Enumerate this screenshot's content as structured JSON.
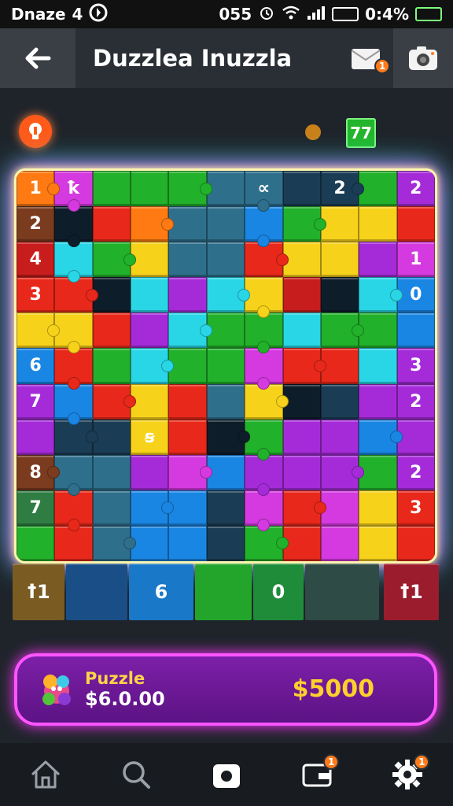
{
  "status_bar": {
    "left_text": "Dnaze",
    "left_num": "4",
    "time": "055",
    "battery_text": "0:4%"
  },
  "app_bar": {
    "title": "Duzzlea Inuzzla",
    "mail_badge": "1",
    "back_icon": "back-arrow-icon",
    "mail_icon": "mail-icon",
    "camera_icon": "camera-icon"
  },
  "game": {
    "level": "77",
    "hint_icon": "hint-bulb-icon",
    "board": {
      "colors": {
        "R": "#e8281a",
        "O": "#ff7a12",
        "Y": "#f7d21a",
        "G": "#22b12a",
        "C": "#29d6e6",
        "B": "#1a86e3",
        "P": "#a52bd9",
        "M": "#d43adf",
        "D": "#1a3d55",
        "T": "#2e6f8c",
        "N": "#c71d1d",
        "K": "#0e1d2a",
        "W": "#7a3b1e",
        "L": "#2f7d43"
      },
      "rows": [
        [
          "O",
          "M",
          "G",
          "G",
          "G",
          "T",
          "T",
          "D",
          "D",
          "G",
          "P"
        ],
        [
          "W",
          "K",
          "R",
          "O",
          "T",
          "T",
          "B",
          "G",
          "Y",
          "Y",
          "R"
        ],
        [
          "N",
          "C",
          "G",
          "Y",
          "T",
          "T",
          "R",
          "Y",
          "Y",
          "P",
          "M"
        ],
        [
          "R",
          "R",
          "K",
          "C",
          "P",
          "C",
          "Y",
          "N",
          "K",
          "C",
          "B"
        ],
        [
          "Y",
          "Y",
          "R",
          "P",
          "C",
          "G",
          "G",
          "C",
          "G",
          "G",
          "B"
        ],
        [
          "B",
          "R",
          "G",
          "C",
          "G",
          "G",
          "M",
          "R",
          "R",
          "C",
          "P"
        ],
        [
          "P",
          "B",
          "R",
          "Y",
          "R",
          "T",
          "Y",
          "K",
          "D",
          "P",
          "P"
        ],
        [
          "P",
          "D",
          "D",
          "Y",
          "R",
          "K",
          "G",
          "P",
          "P",
          "B",
          "P"
        ],
        [
          "W",
          "T",
          "T",
          "P",
          "M",
          "B",
          "P",
          "P",
          "P",
          "G",
          "P"
        ],
        [
          "L",
          "R",
          "T",
          "B",
          "B",
          "D",
          "M",
          "R",
          "M",
          "Y",
          "R"
        ],
        [
          "G",
          "R",
          "T",
          "B",
          "B",
          "D",
          "G",
          "R",
          "M",
          "Y",
          "R"
        ]
      ],
      "labels": {
        "0-0": "1",
        "0-1": "ꝁ",
        "0-6": "∝",
        "0-8": "2",
        "0-10": "2",
        "1-0": "2",
        "2-0": "4",
        "2-10": "1",
        "3-0": "3",
        "3-10": "0",
        "5-0": "6",
        "5-10": "3",
        "6-0": "7",
        "6-10": "2",
        "7-3": "ꞩ",
        "8-0": "8",
        "8-10": "2",
        "9-0": "7",
        "9-10": "3"
      }
    },
    "bottom_tiles": [
      {
        "label": "ꝉ1",
        "color": "#7a5b22"
      },
      {
        "label": "",
        "color": "#1a4e87"
      },
      {
        "label": "6",
        "color": "#1a78c9"
      },
      {
        "label": "",
        "color": "#23a52c"
      },
      {
        "label": "0",
        "color": "#1f8c3a"
      },
      {
        "label": "",
        "color": "#2f4b45"
      },
      {
        "label": "ꝉ1",
        "color": "#9b1c2c"
      }
    ]
  },
  "banner": {
    "label": "Puzzle",
    "price": "$6.0.00",
    "amount": "$5000",
    "icon": "puzzle-mascot-icon"
  },
  "bottom_nav": {
    "items": [
      {
        "name": "home",
        "icon": "home-icon",
        "badge": ""
      },
      {
        "name": "search",
        "icon": "search-icon",
        "badge": ""
      },
      {
        "name": "camera",
        "icon": "camera-icon",
        "badge": ""
      },
      {
        "name": "wallet",
        "icon": "wallet-icon",
        "badge": "1"
      },
      {
        "name": "settings",
        "icon": "gear-icon",
        "badge": "1"
      }
    ]
  }
}
